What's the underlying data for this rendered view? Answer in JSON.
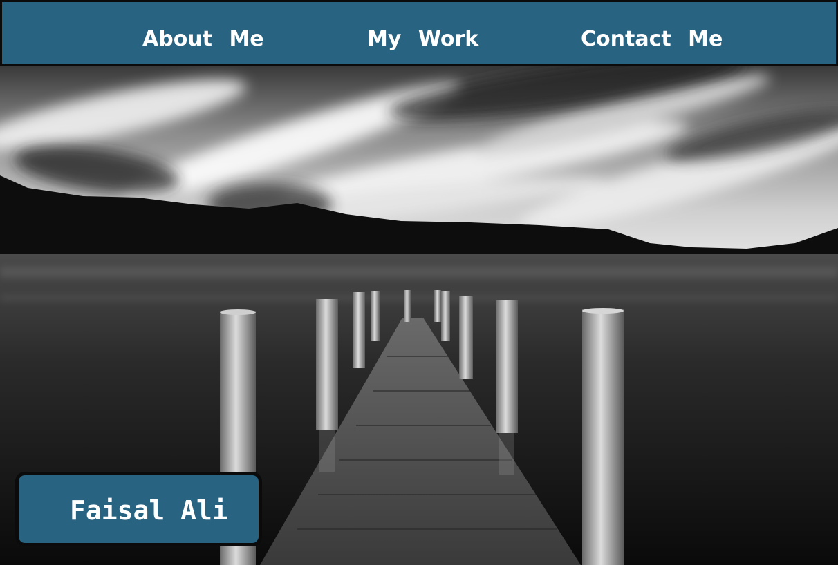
{
  "nav": {
    "items": [
      {
        "label": "About Me"
      },
      {
        "label": "My Work"
      },
      {
        "label": "Contact Me"
      }
    ]
  },
  "hero": {
    "name": "Faisal Ali"
  },
  "colors": {
    "accent": "#286381",
    "border": "#0b0b0b",
    "text": "#ffffff"
  }
}
